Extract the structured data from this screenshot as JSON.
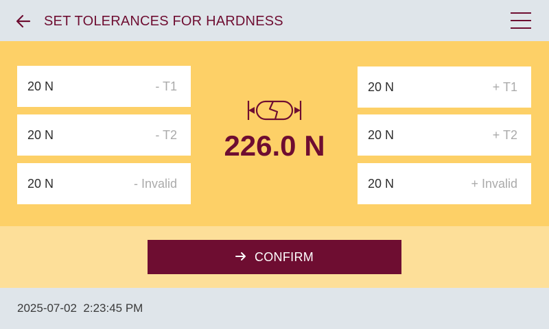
{
  "header": {
    "title": "SET TOLERANCES FOR HARDNESS",
    "back_icon": "arrow-left-icon",
    "menu_icon": "hamburger-menu-icon"
  },
  "tolerances": {
    "minus_t1": {
      "value": "20 N",
      "label": "- T1"
    },
    "minus_t2": {
      "value": "20 N",
      "label": "- T2"
    },
    "minus_invalid": {
      "value": "20 N",
      "label": "- Invalid"
    },
    "plus_t1": {
      "value": "20 N",
      "label": "+ T1"
    },
    "plus_t2": {
      "value": "20 N",
      "label": "+ T2"
    },
    "plus_invalid": {
      "value": "20 N",
      "label": "+ Invalid"
    }
  },
  "measurement": {
    "value": "226.0 N",
    "icon": "tablet-hardness-icon"
  },
  "confirm": {
    "label": "CONFIRM",
    "icon": "arrow-right-icon"
  },
  "footer": {
    "timestamp": "2025-07-02  2:23:45 PM"
  },
  "colors": {
    "accent": "#6e0d31",
    "panel": "#fdd067",
    "confirm_bar": "#fddf99",
    "background": "#dfe5ea"
  }
}
